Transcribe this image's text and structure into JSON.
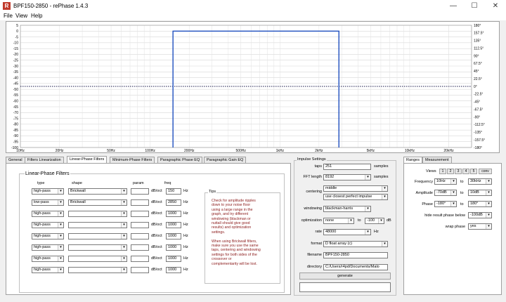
{
  "window": {
    "title": "BPF150-2850  -  rePhase 1.4.3",
    "icon_letter": "R",
    "min_glyph": "—",
    "max_glyph": "☐",
    "close_glyph": "✕"
  },
  "menu": [
    "File",
    "View",
    "Help"
  ],
  "graph": {
    "left_ticks": [
      "5",
      "0",
      "-5",
      "-10",
      "-15",
      "-20",
      "-25",
      "-30",
      "-35",
      "-40",
      "-45",
      "-50",
      "-55",
      "-60",
      "-65",
      "-70",
      "-75",
      "-80",
      "-85",
      "-90",
      "-95",
      "-100"
    ],
    "right_ticks": [
      "180°",
      "157.5°",
      "135°",
      "112.5°",
      "90°",
      "67.5°",
      "45°",
      "22.5°",
      "0°",
      "-22.5°",
      "-45°",
      "-67.5°",
      "-90°",
      "-112.5°",
      "-135°",
      "-157.5°",
      "-180°"
    ],
    "x_ticks": [
      "10Hz",
      "20Hz",
      "50Hz",
      "100Hz",
      "200Hz",
      "500Hz",
      "1kHz",
      "2kHz",
      "5kHz",
      "10kHz",
      "20kHz"
    ],
    "magnitude_color": "#1f4fbf",
    "phase_color": "#1a1a4a"
  },
  "tabs": [
    "General",
    "Filters Linearization",
    "Linear-Phase Filters",
    "Minimum-Phase Filters",
    "Paragraphic Phase EQ",
    "Paragraphic Gain EQ"
  ],
  "active_tab": "Linear-Phase Filters",
  "linear_phase": {
    "title": "Linear-Phase Filters",
    "col_type": "type",
    "col_shape": "shape",
    "col_param": "param",
    "col_freq": "freq",
    "rows": [
      {
        "type": "high-pass",
        "shape": "Brickwall",
        "unit": "dB/oct",
        "freq": "150",
        "hz": "Hz"
      },
      {
        "type": "low-pass",
        "shape": "Brickwall",
        "unit": "dB/oct",
        "freq": "2850",
        "hz": "Hz"
      },
      {
        "type": "high-pass",
        "shape": "",
        "unit": "dB/oct",
        "freq": "1000",
        "hz": "Hz"
      },
      {
        "type": "high-pass",
        "shape": "",
        "unit": "dB/oct",
        "freq": "1000",
        "hz": "Hz"
      },
      {
        "type": "high-pass",
        "shape": "",
        "unit": "dB/oct",
        "freq": "1000",
        "hz": "Hz"
      },
      {
        "type": "high-pass",
        "shape": "",
        "unit": "dB/oct",
        "freq": "1000",
        "hz": "Hz"
      },
      {
        "type": "high-pass",
        "shape": "",
        "unit": "dB/oct",
        "freq": "1000",
        "hz": "Hz"
      },
      {
        "type": "high-pass",
        "shape": "",
        "unit": "dB/oct",
        "freq": "1000",
        "hz": "Hz"
      }
    ],
    "tips_title": "Tips",
    "tips_lines": [
      "Check for amplitude ripples",
      "down to your noise floor",
      "using a large range in the",
      "graph, and try different",
      "windowing (blackman or",
      "nuttall should give good",
      "results) and optimization",
      "settings.",
      "",
      "When using Brickwall filters,",
      "make sure you use the same",
      "taps, centering and windowing",
      "settings for both sides of the",
      "crossover or",
      "complementarity will be lost."
    ]
  },
  "impulse": {
    "title": "Impulse Settings",
    "taps_label": "taps",
    "taps": "251",
    "taps_unit": "samples",
    "fft_label": "FFT length",
    "fft": "8192",
    "fft_unit": "samples",
    "centering_label": "centering",
    "centering": "middle",
    "centering2": "use closest perfect impulse",
    "windowing_label": "windowing",
    "windowing": "blackman-harris",
    "optimization_label": "optimization",
    "optimization": "none",
    "to_label": "to",
    "optimization_db": "-100",
    "db_unit": "dB",
    "rate_label": "rate",
    "rate": "48000",
    "rate_unit": "Hz",
    "format_label": "format",
    "format": "D float array (c)",
    "filename_label": "filename",
    "filename": "BPF150-2850",
    "directory_label": "directory",
    "directory": "C:/Users/r4pd/Documents/Malo",
    "generate_label": "generate"
  },
  "ranges": {
    "tab_ranges": "Ranges",
    "tab_measurement": "Measurement",
    "views_label": "Views",
    "view_buttons": [
      "1",
      "2",
      "3",
      "4",
      "5",
      "conv"
    ],
    "frequency_label": "Frequency",
    "freq_from": "10Hz",
    "freq_to": "30kHz",
    "to_label": "to",
    "amplitude_label": "Amplitude",
    "amp_from": "-70dB",
    "amp_to": "10dB",
    "phase_label": "Phase",
    "phase_from": "-180°",
    "phase_to": "180°",
    "hide_label": "hide result phase below",
    "hide_value": "-100dB",
    "wrap_label": "wrap phase",
    "wrap_value": "yes"
  }
}
